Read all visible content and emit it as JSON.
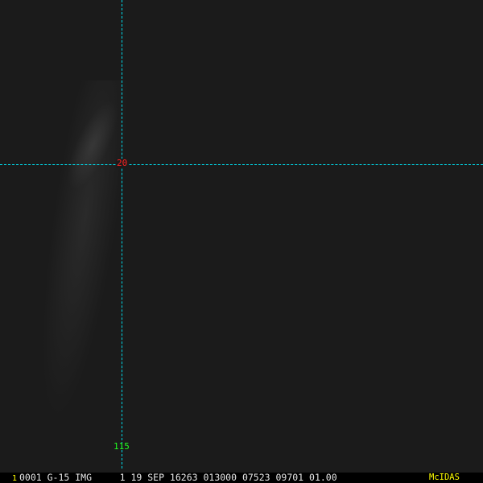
{
  "overlay": {
    "latitude_label": "20",
    "longitude_label": "115",
    "grid_color": "#00d8e8",
    "latitude_label_color": "#ff2020",
    "longitude_label_color": "#20ff20"
  },
  "status_bar": {
    "frame_number": "1",
    "info": "0001 G-15 IMG     1 19 SEP 16263 013000 07523 09701 01.00",
    "brand": "McIDAS"
  }
}
